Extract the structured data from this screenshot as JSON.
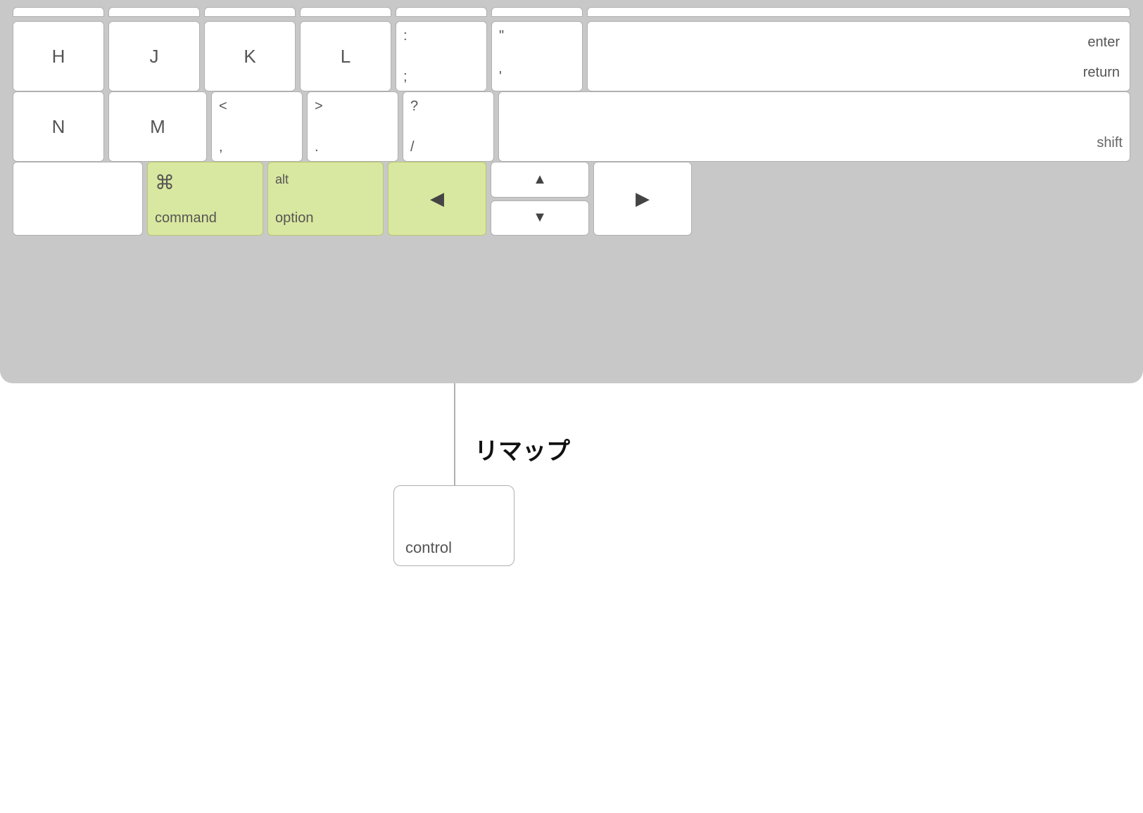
{
  "keyboard": {
    "background_color": "#c8c8c8",
    "highlight_color": "#d9e8a0",
    "rows": {
      "row0": {
        "keys": [
          "",
          "",
          "",
          "",
          "",
          "",
          "\\"
        ]
      },
      "row1": {
        "keys": [
          {
            "main": "H"
          },
          {
            "main": "J"
          },
          {
            "main": "K"
          },
          {
            "main": "L"
          },
          {
            "top": ":",
            "bottom": ";"
          },
          {
            "top": "\"",
            "bottom": "'"
          },
          {
            "top": "enter",
            "bottom": "return"
          }
        ]
      },
      "row2": {
        "keys": [
          {
            "main": "N"
          },
          {
            "main": "M"
          },
          {
            "top": "<",
            "bottom": ","
          },
          {
            "top": ">",
            "bottom": "."
          },
          {
            "top": "?",
            "bottom": "/"
          },
          {
            "label": "shift"
          }
        ]
      },
      "row3": {
        "keys": [
          {
            "label": ""
          },
          {
            "symbol": "⌘",
            "label": "command",
            "highlighted": true
          },
          {
            "top": "alt",
            "label": "option",
            "highlighted": true
          },
          {
            "arrow": "◀",
            "highlighted": true
          },
          {
            "up": "▲",
            "down": "▼"
          },
          {
            "arrow": "▶"
          }
        ]
      }
    },
    "connector": {
      "visible": true
    },
    "remap_label": "リマップ",
    "control_key": {
      "label": "control"
    }
  }
}
